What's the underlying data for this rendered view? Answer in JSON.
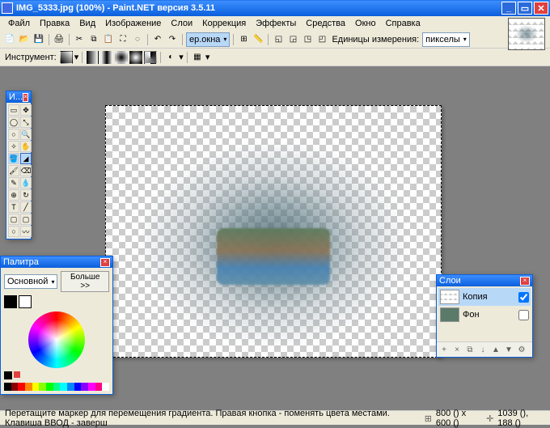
{
  "titlebar": {
    "filename": "IMG_5333.jpg",
    "zoom": "(100%)",
    "app": "Paint.NET версия 3.5.11"
  },
  "menu": {
    "file": "Файл",
    "edit": "Правка",
    "view": "Вид",
    "image": "Изображение",
    "layers": "Слои",
    "adjustments": "Коррекция",
    "effects": "Эффекты",
    "tools": "Средства",
    "window": "Окно",
    "help": "Справка"
  },
  "toolbar": {
    "window_size": "ер.окна",
    "units_label": "Единицы измерения:",
    "units_value": "пикселы",
    "tool_label": "Инструмент:"
  },
  "colors": {
    "title": "Палитра",
    "primary": "Основной",
    "more": "Больше >>",
    "fg": "#000000",
    "bg": "#FFFFFF"
  },
  "layers": {
    "title": "Слои",
    "items": [
      {
        "name": "Копия",
        "visible": true,
        "active": true
      },
      {
        "name": "Фон",
        "visible": false,
        "active": false
      }
    ]
  },
  "tools_panel": {
    "title": "И..."
  },
  "status": {
    "hint": "Перетащите маркер для перемещения градиента. Правая кнопка - поменять цвета местами. Клавиша ВВОД - заверш",
    "dimensions": "800 () x 600 ()",
    "coords": "1039 (), 188 ()"
  }
}
